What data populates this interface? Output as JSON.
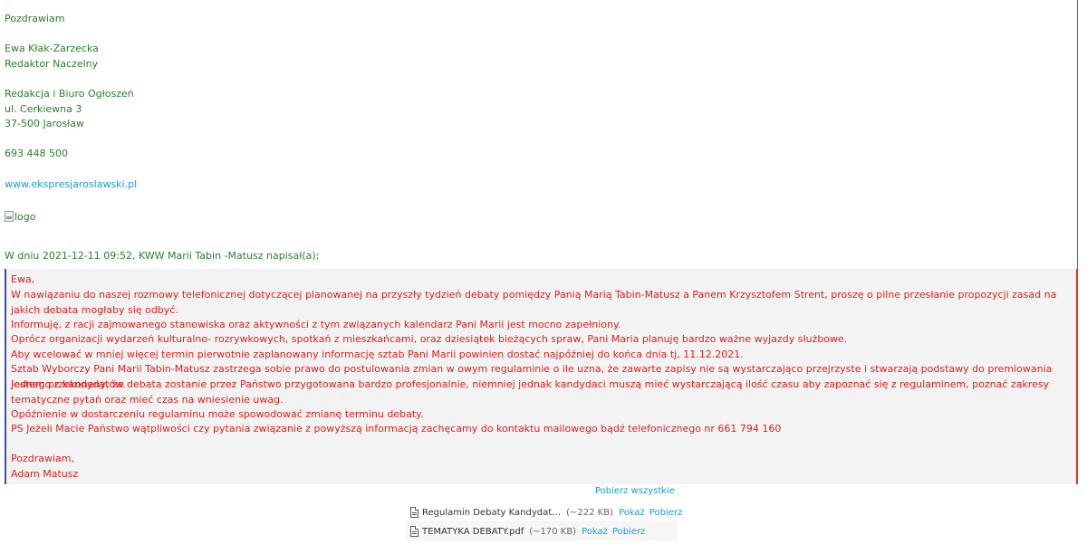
{
  "signature": {
    "closing": "Pozdrawiam",
    "name": "Ewa Kłak-Zarzecka",
    "position": "Redaktor Naczelny",
    "office": "Redakcja i Biuro Ogłoszeń",
    "street": "ul. Cerkiewna 3",
    "city": "37-500 Jarosław",
    "phone": "693 448 500",
    "website": "www.ekspresjaroslawski.pl",
    "logo_alt": "logo"
  },
  "quote_header": "W dniu 2021-12-11 09:52, KWW Marii Tabin -Matusz napisał(a):",
  "quote": {
    "lines": [
      "Ewa,",
      "W nawiązaniu  do naszej rozmowy  telefonicznej  dotyczącej  planowanej  na przyszły tydzień  debaty  pomiędzy Panią Marią Tabin-Matusz a Panem Krzysztofem Strent, proszę o pilne  przesłanie propozycji zasad na jakich debata mogłaby się odbyć.",
      "Informuję, z racji zajmowanego stanowiska oraz  aktywności z tym związanych kalendarz Pani Marii jest mocno zapełniony.",
      "Oprócz organizacji wydarzeń  kulturalno- rozrywkowych, spotkań  z mieszkańcami, oraz dziesiątek  bieżących spraw, Pani Maria planuję  bardzo ważne wyjazdy służbowe.",
      "Aby wcelować w mniej więcej termin pierwotnie zaplanowany informację sztab Pani Marii powinien dostać  najpóźniej do końca dnia tj, 11.12.2021.",
      "Sztab Wyborczy Pani Marii Tabin-Matusz zastrzega sobie prawo do postulowania zmian w owym regulaminie o ile uzna, że zawarte zapisy nie są wystarczająco przejrzyste i stwarzają podstawy do premiowania jednego z kandydatów.",
      "Jestem przekonany, że debata zostanie przez Państwo  przygotowana bardzo profesjonalnie, niemniej jednak  kandydaci muszą mieć wystarczającą ilość czasu aby zapoznać  się z regulaminem, poznać zakresy tematyczne pytań oraz mieć czas na wniesienie uwag.",
      "Opóźnienie w dostarczeniu regulaminu może spowodować zmianę terminu debaty.",
      "PS  Jeżeli  Macie Państwo wątpliwości czy pytania związanie z powyższą informacją  zachęcamy  do  kontaktu mailowego  bądź telefonicznego nr 661 794 160",
      "",
      "Pozdrawiam,",
      "Adam Matusz"
    ]
  },
  "attachments": {
    "download_all_label": "Pobierz wszystkie",
    "files": [
      {
        "name": "Regulamin Debaty Kandydat…",
        "size": "(~222 KB)",
        "preview_label": "Pokaż",
        "download_label": "Pobierz"
      },
      {
        "name": "TEMATYKA DEBATY.pdf",
        "size": "(~170 KB)",
        "preview_label": "Pokaż",
        "download_label": "Pobierz"
      }
    ]
  }
}
